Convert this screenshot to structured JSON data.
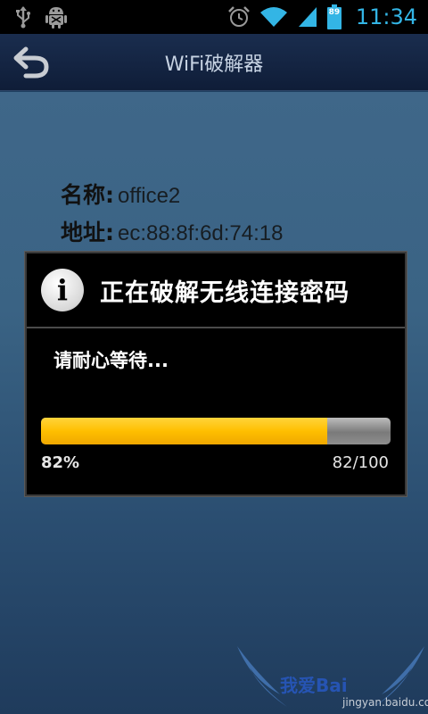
{
  "status_bar": {
    "time": "11:34",
    "battery_level": "89",
    "icons": [
      "usb-icon",
      "android-debug-icon",
      "alarm-icon",
      "wifi-icon",
      "signal-icon",
      "battery-icon"
    ]
  },
  "title_bar": {
    "title": "WiFi破解器",
    "back_icon": "back-arrow-icon"
  },
  "network_info": [
    {
      "label": "名称:",
      "value": "office2"
    },
    {
      "label": "地址:",
      "value": "ec:88:8f:6d:74:18"
    }
  ],
  "dialog": {
    "icon": "info-icon",
    "title": "正在破解无线连接密码",
    "message": "请耐心等待...",
    "progress_percent_text": "82%",
    "progress_count_text": "82/100",
    "progress_value": 82,
    "progress_max": 100
  },
  "watermark": {
    "text1": "我爱Bai",
    "text2": "jingyan.baidu.com"
  },
  "colors": {
    "time": "#33b5e5",
    "progress_fill": "#ffbf00",
    "dialog_bg": "#000000",
    "titlebar_bg": "#13264a"
  }
}
